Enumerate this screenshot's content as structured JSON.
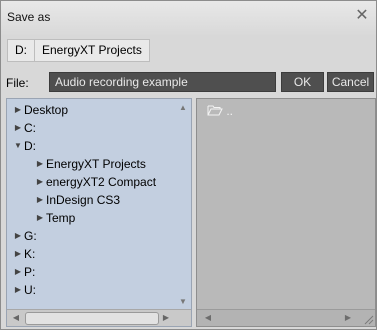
{
  "window": {
    "title": "Save as",
    "close_glyph": "✕"
  },
  "pathbar": {
    "drive": "D:",
    "folder": "EnergyXT Projects"
  },
  "file": {
    "label": "File:",
    "value": "Audio recording example",
    "ok_label": "OK",
    "cancel_label": "Cancel"
  },
  "tree": {
    "items": [
      {
        "label": "Desktop",
        "expanded": false
      },
      {
        "label": "C:",
        "expanded": false
      },
      {
        "label": "D:",
        "expanded": true
      },
      {
        "label": "EnergyXT Projects",
        "expanded": false
      },
      {
        "label": "energyXT2 Compact",
        "expanded": false
      },
      {
        "label": "InDesign CS3",
        "expanded": false
      },
      {
        "label": "Temp",
        "expanded": false
      },
      {
        "label": "G:",
        "expanded": false
      },
      {
        "label": "K:",
        "expanded": false
      },
      {
        "label": "P:",
        "expanded": false
      },
      {
        "label": "U:",
        "expanded": false
      }
    ]
  },
  "files": {
    "entries": [
      {
        "label": "..",
        "icon": "open-folder-icon"
      }
    ]
  },
  "icons": {
    "collapsed": "collapsed-arrow-icon",
    "expanded": "expanded-arrow-icon",
    "scroll_up": "scroll-up-icon",
    "scroll_down": "scroll-down-icon",
    "scroll_left": "scroll-left-icon",
    "scroll_right": "scroll-right-icon",
    "resize": "resize-grip-icon"
  },
  "colors": {
    "tree_background": "#c3cfe0",
    "files_background": "#b9b9b9",
    "dark_control": "#4f4f4f"
  }
}
